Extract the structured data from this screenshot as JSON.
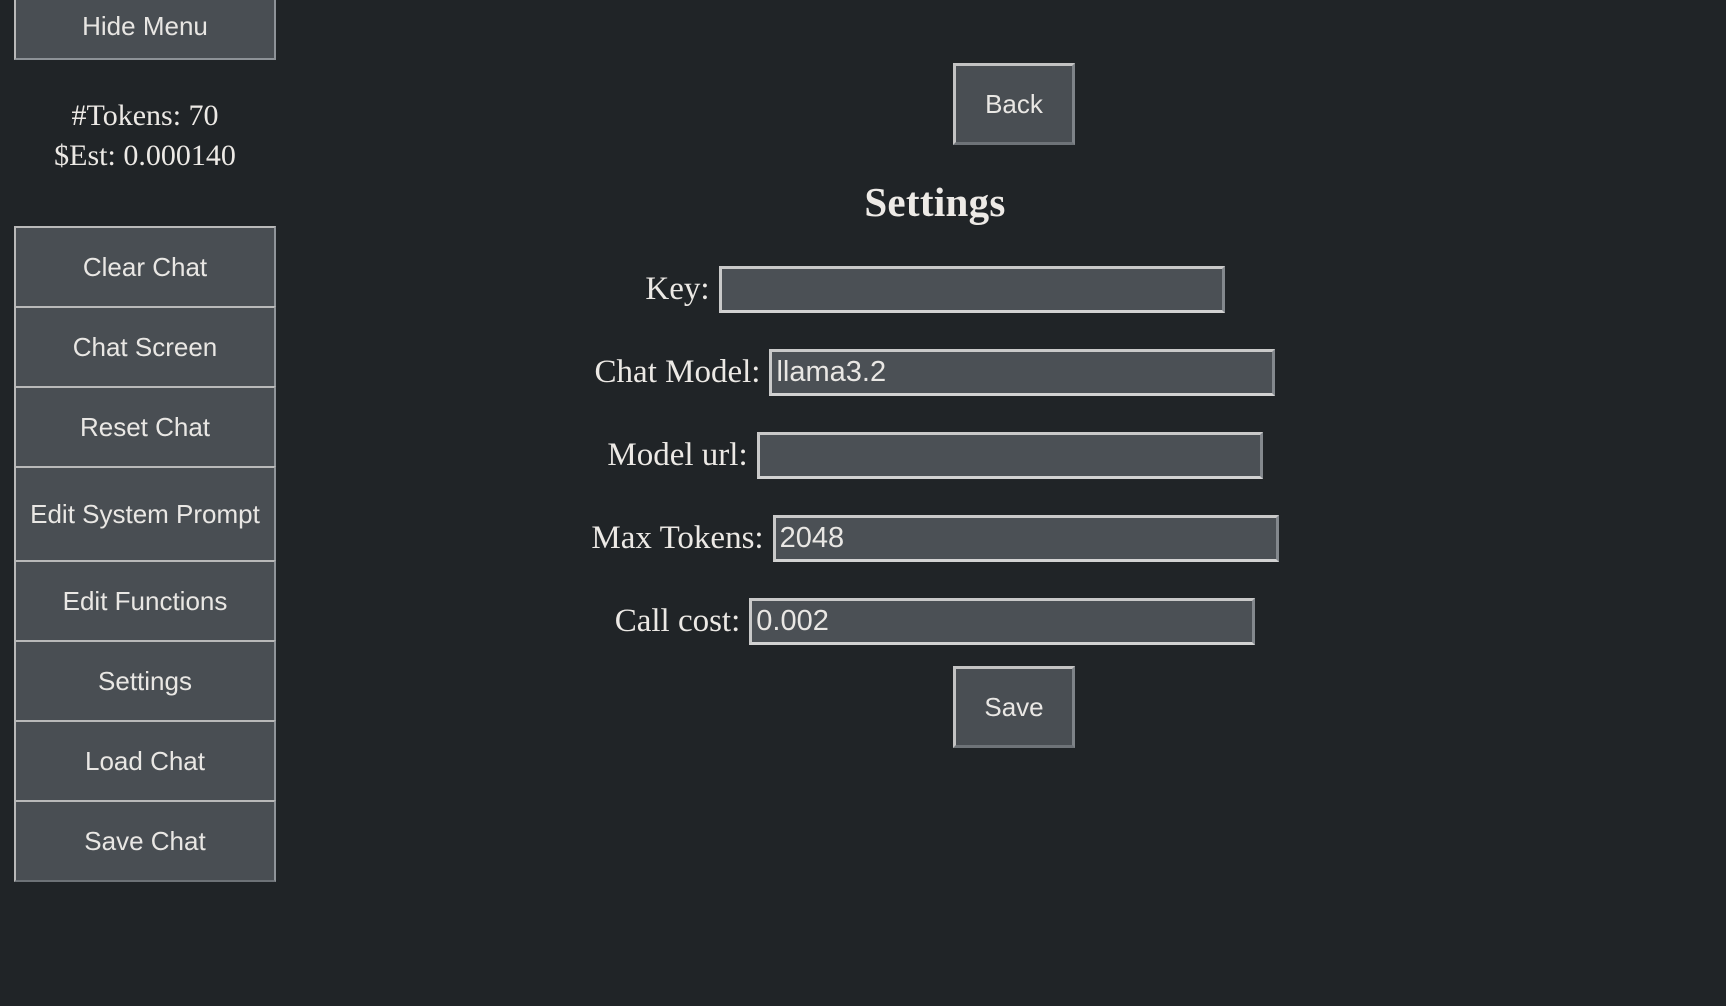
{
  "colors": {
    "background": "#202427",
    "control_fill": "#494e53",
    "input_fill": "#4b5055",
    "border_light": "#c3c3c3",
    "text": "#e9e7e4"
  },
  "sidebar": {
    "hide_menu_label": "Hide Menu",
    "token_count_line": "#Tokens: 70",
    "cost_estimate_line": "$Est: 0.000140",
    "items": [
      {
        "label": "Clear Chat"
      },
      {
        "label": "Chat Screen"
      },
      {
        "label": "Reset Chat"
      },
      {
        "label": "Edit System Prompt"
      },
      {
        "label": "Edit Functions"
      },
      {
        "label": "Settings"
      },
      {
        "label": "Load Chat"
      },
      {
        "label": "Save Chat"
      }
    ]
  },
  "main": {
    "back_label": "Back",
    "title": "Settings",
    "save_label": "Save",
    "fields": [
      {
        "label": "Key:",
        "value": "",
        "placeholder": ""
      },
      {
        "label": "Chat Model:",
        "value": "llama3.2",
        "placeholder": ""
      },
      {
        "label": "Model url:",
        "value": "",
        "placeholder": ""
      },
      {
        "label": "Max Tokens:",
        "value": "2048",
        "placeholder": ""
      },
      {
        "label": "Call cost:",
        "value": "0.002",
        "placeholder": ""
      }
    ]
  }
}
